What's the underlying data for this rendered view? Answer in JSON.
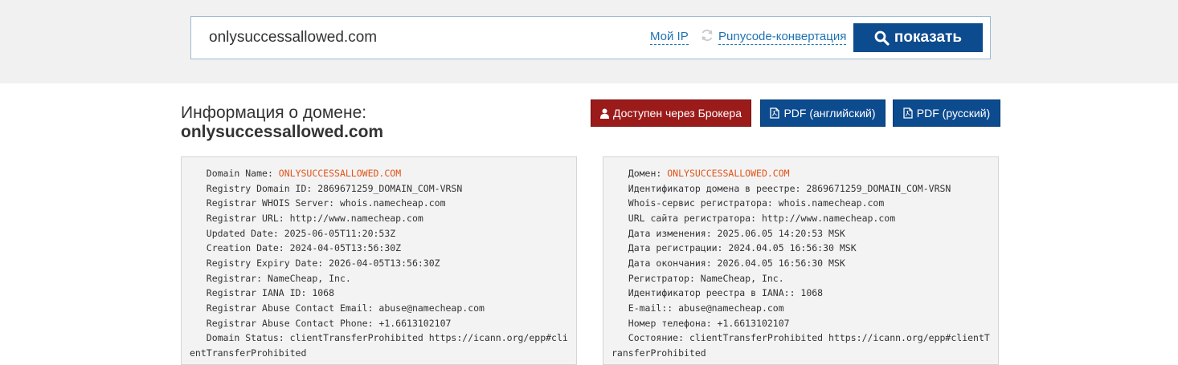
{
  "search": {
    "value": "onlysuccessallowed.com",
    "my_ip_label": "Мой IP",
    "punycode_label": "Punycode-конвертация",
    "show_label": "показать"
  },
  "heading": {
    "line1": "Информация о домене:",
    "line2": "onlysuccessallowed.com"
  },
  "buttons": {
    "broker": "Доступен через Брокера",
    "pdf_en": "PDF (английский)",
    "pdf_ru": "PDF (русский)"
  },
  "whois_en": [
    {
      "prefix": "   Domain Name: ",
      "value": "ONLYSUCCESSALLOWED.COM"
    },
    {
      "text": "   Registry Domain ID: 2869671259_DOMAIN_COM-VRSN"
    },
    {
      "text": "   Registrar WHOIS Server: whois.namecheap.com"
    },
    {
      "text": "   Registrar URL: http://www.namecheap.com"
    },
    {
      "text": "   Updated Date: 2025-06-05T11:20:53Z"
    },
    {
      "text": "   Creation Date: 2024-04-05T13:56:30Z"
    },
    {
      "text": "   Registry Expiry Date: 2026-04-05T13:56:30Z"
    },
    {
      "text": "   Registrar: NameCheap, Inc."
    },
    {
      "text": "   Registrar IANA ID: 1068"
    },
    {
      "text": "   Registrar Abuse Contact Email: abuse@namecheap.com"
    },
    {
      "text": "   Registrar Abuse Contact Phone: +1.6613102107"
    },
    {
      "text": "   Domain Status: clientTransferProhibited https://icann.org/epp#clientTransferProhibited"
    }
  ],
  "whois_ru": [
    {
      "prefix": "   Домен: ",
      "value": "ONLYSUCCESSALLOWED.COM"
    },
    {
      "text": "   Идентификатор домена в реестре: 2869671259_DOMAIN_COM-VRSN"
    },
    {
      "text": "   Whois-сервис регистратора: whois.namecheap.com"
    },
    {
      "text": "   URL сайта регистратора: http://www.namecheap.com"
    },
    {
      "text": "   Дата изменения: 2025.06.05 14:20:53 MSK"
    },
    {
      "text": "   Дата регистрации: 2024.04.05 16:56:30 MSK"
    },
    {
      "text": "   Дата окончания: 2026.04.05 16:56:30 MSK"
    },
    {
      "text": "   Регистратор: NameCheap, Inc."
    },
    {
      "text": "   Идентификатор реестра в IANA:: 1068"
    },
    {
      "text": "   E-mail:: abuse@namecheap.com"
    },
    {
      "text": "   Номер телефона: +1.6613102107"
    },
    {
      "text": "   Состояние: clientTransferProhibited https://icann.org/epp#clientTransferProhibited"
    }
  ],
  "colors": {
    "primary": "#0d4b8f",
    "broker": "#9b1b1b",
    "link": "#1f73b3",
    "highlight": "#e0531a"
  },
  "icons": {
    "search": "search-icon",
    "refresh": "refresh-icon",
    "user": "user-icon",
    "pdf": "pdf-file-icon"
  }
}
